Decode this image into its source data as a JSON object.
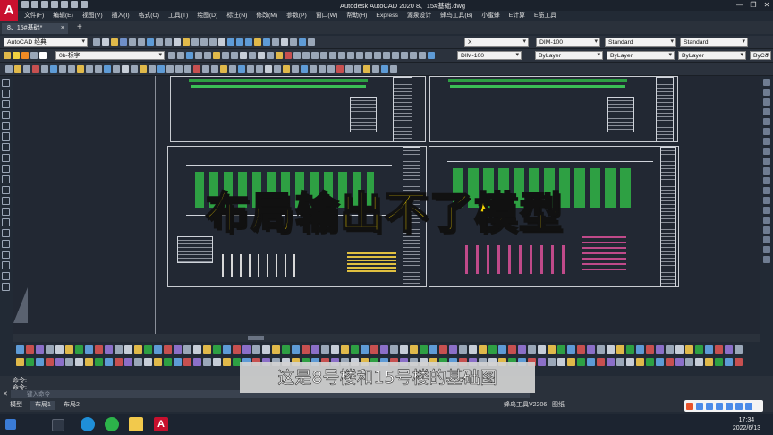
{
  "app": {
    "logo_letter": "A",
    "window_title": "Autodesk AutoCAD 2020    8、15#基础.dwg",
    "window_controls": [
      "—",
      "❐",
      "✕"
    ]
  },
  "menu": [
    "文件(F)",
    "编辑(E)",
    "视图(V)",
    "插入(I)",
    "格式(O)",
    "工具(T)",
    "绘图(D)",
    "标注(N)",
    "修改(M)",
    "参数(P)",
    "窗口(W)",
    "帮助(H)",
    "Express",
    "源泉设计",
    "蜂鸟工具(B)",
    "小蜜蜂",
    "E计算",
    "E筋工具"
  ],
  "tabs": {
    "active": "8、15#基础*",
    "close": "×",
    "new": "+"
  },
  "toolbar": {
    "workspace": "AutoCAD 经典",
    "layer": "0b-标字",
    "text_style": "X",
    "dim_style": "DIM-100",
    "table_style": "Standard",
    "multileader_style": "Standard",
    "dim_style_2": "DIM-100",
    "color": "ByLayer",
    "linetype": "ByLayer",
    "lineweight": "ByLayer",
    "plot_style": "ByCo"
  },
  "overlay_caption": "布局输出不了模型",
  "subtitle": "这是8号楼和15号楼的基础图",
  "command": {
    "history": [
      "命令:",
      "命令:"
    ],
    "placeholder": "键入命令",
    "close": "✕"
  },
  "layout_tabs": [
    "模型",
    "布局1",
    "布局2"
  ],
  "status": {
    "plugin": "蜂鸟工具V2206",
    "mode": "图纸"
  },
  "taskbar": {
    "time": "17:34",
    "date": "2022/6/13"
  },
  "colors": {
    "accent": "#c8102e",
    "canvas": "#222833",
    "overlay_text": "#f5d400",
    "drawing_green": "#2ea043"
  }
}
